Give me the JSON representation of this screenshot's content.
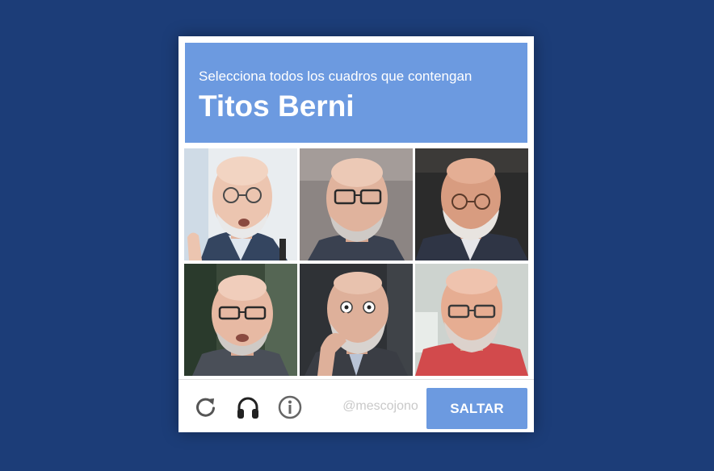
{
  "captcha": {
    "instruction": "Selecciona todos los cuadros que contengan",
    "target": "Titos Berni",
    "tiles": [
      {
        "icon": "bald-man-with-glasses-photo-1"
      },
      {
        "icon": "bald-man-with-glasses-photo-2"
      },
      {
        "icon": "bald-man-with-glasses-photo-3"
      },
      {
        "icon": "bald-man-with-glasses-photo-4"
      },
      {
        "icon": "bald-man-with-glasses-photo-5"
      },
      {
        "icon": "bald-man-with-glasses-photo-6"
      }
    ],
    "footer": {
      "reload_icon": "reload-icon",
      "audio_icon": "headphones-icon",
      "info_icon": "info-icon",
      "watermark": "@mescojono",
      "skip_label": "SALTAR"
    }
  },
  "colors": {
    "page_background": "#1c3d78",
    "accent": "#6c9ae0",
    "widget_background": "#ffffff"
  }
}
